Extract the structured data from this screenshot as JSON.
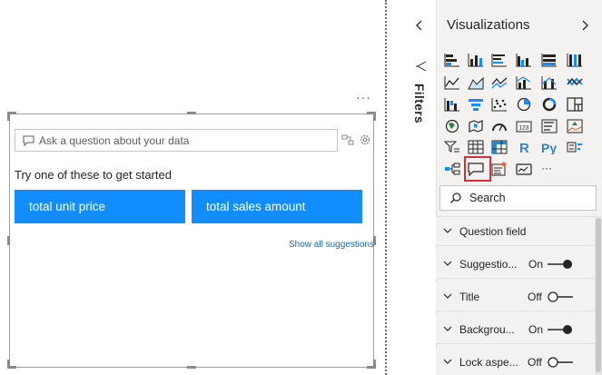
{
  "visual": {
    "more_options": "···",
    "qa_placeholder": "Ask a question about your data",
    "try_text": "Try one of these to get started",
    "suggestions": [
      "total unit price",
      "total sales amount"
    ],
    "show_all": "Show all suggestions"
  },
  "filters_pane": {
    "label": "Filters"
  },
  "viz_pane": {
    "title": "Visualizations",
    "search_label": "Search",
    "icons": [
      "stacked-bar-chart-icon",
      "stacked-column-chart-icon",
      "clustered-bar-chart-icon",
      "clustered-column-chart-icon",
      "100-stacked-bar-chart-icon",
      "100-stacked-column-chart-icon",
      "line-chart-icon",
      "area-chart-icon",
      "stacked-area-chart-icon",
      "line-and-column-chart-icon",
      "line-and-clustered-column-chart-icon",
      "ribbon-chart-icon",
      "waterfall-chart-icon",
      "funnel-chart-icon",
      "scatter-chart-icon",
      "pie-chart-icon",
      "donut-chart-icon",
      "treemap-icon",
      "map-icon",
      "filled-map-icon",
      "gauge-icon",
      "card-icon",
      "multi-row-card-icon",
      "kpi-icon",
      "slicer-icon",
      "table-icon",
      "matrix-icon",
      "r-visual-icon",
      "python-visual-icon",
      "key-influencers-icon",
      "decomposition-tree-icon",
      "qa-icon",
      "smart-narrative-icon",
      "paginated-report-icon",
      "more-visuals-icon"
    ],
    "r_label": "R",
    "py_label": "Py",
    "more_label": "···",
    "cards": [
      {
        "label": "Question field",
        "toggle": "",
        "on": null
      },
      {
        "label": "Suggestio...",
        "toggle": "On",
        "on": true
      },
      {
        "label": "Title",
        "toggle": "Off",
        "on": false
      },
      {
        "label": "Backgrou...",
        "toggle": "On",
        "on": true
      },
      {
        "label": "Lock aspe...",
        "toggle": "Off",
        "on": false
      }
    ]
  },
  "colors": {
    "accent": "#118dff",
    "selection": "#d13438",
    "pane_bg": "#f3f2f1"
  }
}
